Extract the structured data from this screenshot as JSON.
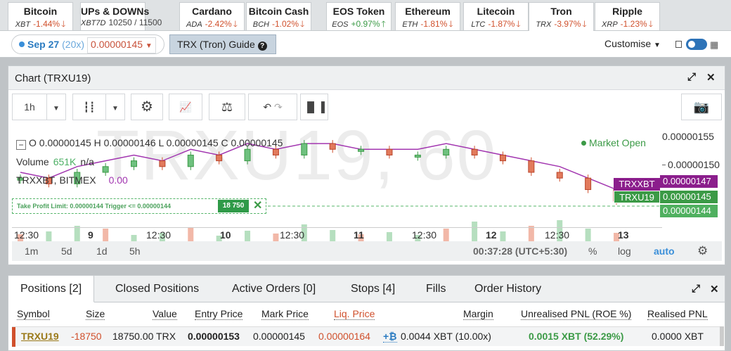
{
  "tickers": [
    {
      "name": "Bitcoin",
      "sym": "XBT",
      "pct": "-1.44%",
      "arrow": "🡓",
      "dir": "down"
    },
    {
      "name": "UPs & DOWNs",
      "sym": "XBT7D",
      "pct": "10250 / 11500",
      "arrow": "",
      "dir": "neutral"
    },
    {
      "name": "Cardano",
      "sym": "ADA",
      "pct": "-2.42%",
      "arrow": "🡓",
      "dir": "down"
    },
    {
      "name": "Bitcoin Cash",
      "sym": "BCH",
      "pct": "-1.02%",
      "arrow": "🡓",
      "dir": "down"
    },
    {
      "name": "EOS Token",
      "sym": "EOS",
      "pct": "+0.97%",
      "arrow": "🡑",
      "dir": "up"
    },
    {
      "name": "Ethereum",
      "sym": "ETH",
      "pct": "-1.81%",
      "arrow": "🡓",
      "dir": "down"
    },
    {
      "name": "Litecoin",
      "sym": "LTC",
      "pct": "-1.87%",
      "arrow": "🡓",
      "dir": "down"
    },
    {
      "name": "Tron",
      "sym": "TRX",
      "pct": "-3.97%",
      "arrow": "🡓",
      "dir": "down",
      "active": true
    },
    {
      "name": "Ripple",
      "sym": "XRP",
      "pct": "-1.23%",
      "arrow": "🡓",
      "dir": "down"
    }
  ],
  "contract": {
    "date": "Sep 27",
    "multiplier": "(20x)",
    "price": "0.00000145"
  },
  "guide_label": "TRX (Tron) Guide",
  "customise_label": "Customise",
  "chart_panel": {
    "title": "Chart (TRXU19)"
  },
  "toolbar": {
    "interval": "1h"
  },
  "chart": {
    "watermark": "TRXU19, 60",
    "ohlc": "O 0.00000145  H 0.00000146  L 0.00000145  C 0.00000145",
    "volume_label": "Volume",
    "volume_value": "651K",
    "volume_na": "n/a",
    "source": "TRXXBT, BITMEX",
    "source_value": "0.00",
    "market_status": "Market Open",
    "y_labels": [
      "0.00000155",
      "0.00000150"
    ],
    "badge_trxxbt": {
      "sym": "TRXXBT",
      "value": "0.00000147"
    },
    "badge_trxu19": {
      "sym": "TRXU19",
      "value": "0.00000145"
    },
    "badge_last": "0.00000144",
    "take_profit": "Take Profit Limit: 0.00000144  Trigger <= 0.00000144",
    "take_profit_qty": "18 750",
    "x_labels": [
      "12:30",
      "9",
      "12:30",
      "10",
      "12:30",
      "11",
      "12:30",
      "12",
      "12:30",
      "13"
    ]
  },
  "chart_data": {
    "type": "line",
    "series": [
      {
        "name": "TRXU19",
        "values": [
          1.49e-06,
          1.48e-06,
          1.5e-06,
          1.51e-06,
          1.52e-06,
          1.51e-06,
          1.53e-06,
          1.52e-06,
          1.54e-06,
          1.53e-06,
          1.55e-06,
          1.54e-06,
          1.54e-06,
          1.53e-06,
          1.53e-06,
          1.54e-06,
          1.53e-06,
          1.52e-06,
          1.5e-06,
          1.49e-06,
          1.47e-06,
          1.45e-06
        ]
      },
      {
        "name": "TRXXBT",
        "values": [
          1.5e-06,
          1.49e-06,
          1.51e-06,
          1.52e-06,
          1.53e-06,
          1.52e-06,
          1.54e-06,
          1.53e-06,
          1.55e-06,
          1.54e-06,
          1.55e-06,
          1.55e-06,
          1.54e-06,
          1.54e-06,
          1.54e-06,
          1.55e-06,
          1.54e-06,
          1.53e-06,
          1.52e-06,
          1.51e-06,
          1.49e-06,
          1.47e-06
        ]
      }
    ]
  },
  "range_bar": {
    "ranges": [
      "1m",
      "5d",
      "1d",
      "5h"
    ],
    "time": "00:37:28 (UTC+5:30)",
    "pct": "%",
    "log": "log",
    "auto": "auto"
  },
  "positions": {
    "tabs": [
      "Positions [2]",
      "Closed Positions",
      "Active Orders [0]",
      "Stops [4]",
      "Fills",
      "Order History"
    ],
    "headers": [
      "Symbol",
      "Size",
      "Value",
      "Entry Price",
      "Mark Price",
      "Liq. Price",
      "Margin",
      "Unrealised PNL (ROE %)",
      "Realised PNL"
    ],
    "row": {
      "symbol": "TRXU19",
      "size": "-18750",
      "value": "18750.00 TRX",
      "entry": "0.00000153",
      "mark": "0.00000145",
      "liq": "0.00000164",
      "margin_btn": "+₿",
      "margin": "0.0044 XBT (10.00x)",
      "upnl": "0.0015 XBT (52.29%)",
      "rpnl": "0.0000 XBT"
    }
  }
}
